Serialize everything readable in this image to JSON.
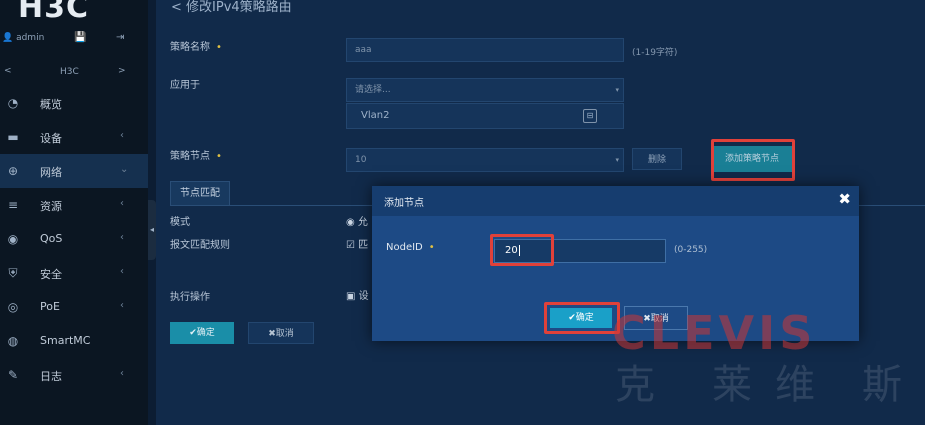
{
  "app": {
    "logo": "H3C"
  },
  "user": {
    "name": "admin",
    "save_icon": "save-icon",
    "logout_icon": "logout-icon"
  },
  "device": {
    "prev": "<",
    "name": "H3C",
    "next": ">"
  },
  "sidebar": {
    "items": [
      {
        "label": "概览",
        "icon": "dashboard-icon"
      },
      {
        "label": "设备",
        "icon": "device-icon",
        "arrow": "‹"
      },
      {
        "label": "网络",
        "icon": "globe-icon",
        "arrow": "⌄"
      },
      {
        "label": "资源",
        "icon": "database-icon",
        "arrow": "‹"
      },
      {
        "label": "QoS",
        "icon": "qos-icon",
        "arrow": "‹"
      },
      {
        "label": "安全",
        "icon": "shield-icon",
        "arrow": "‹"
      },
      {
        "label": "PoE",
        "icon": "poe-icon",
        "arrow": "‹"
      },
      {
        "label": "SmartMC",
        "icon": "smartmc-icon",
        "arrow": ""
      },
      {
        "label": "日志",
        "icon": "log-icon",
        "arrow": "‹"
      }
    ]
  },
  "page": {
    "back_title": "< 修改IPv4策略路由"
  },
  "form": {
    "policy_name_label": "策略名称",
    "policy_name_value": "aaa",
    "policy_name_hint": "(1-19字符)",
    "apply_label": "应用于",
    "apply_placeholder": "请选择...",
    "apply_selected": "Vlan2",
    "node_label": "策略节点",
    "node_value": "10",
    "delete_button": "删除",
    "add_node_button": "添加策略节点",
    "tab_label": "节点匹配",
    "mode_label": "模式",
    "mode_value": "允",
    "match_rule_label": "报文匹配规则",
    "match_rule_value": "匹",
    "action_label": "执行操作",
    "action_value": "设",
    "ok_button": "✔确定",
    "cancel_button": "✖取消"
  },
  "dialog": {
    "title": "添加节点",
    "close": "✖",
    "field_label": "NodeID",
    "field_value": "20",
    "field_hint": "(0-255)",
    "ok_button": "✔确定",
    "cancel_button": "✖取消"
  },
  "watermark": {
    "latin": "CLEVIS",
    "cn": [
      "克",
      "莱",
      "维",
      "斯"
    ]
  },
  "colors": {
    "accent": "#1aa0c8",
    "warning": "#e0c043",
    "highlight": "#e0413a",
    "dialog": "#1d4a85"
  }
}
